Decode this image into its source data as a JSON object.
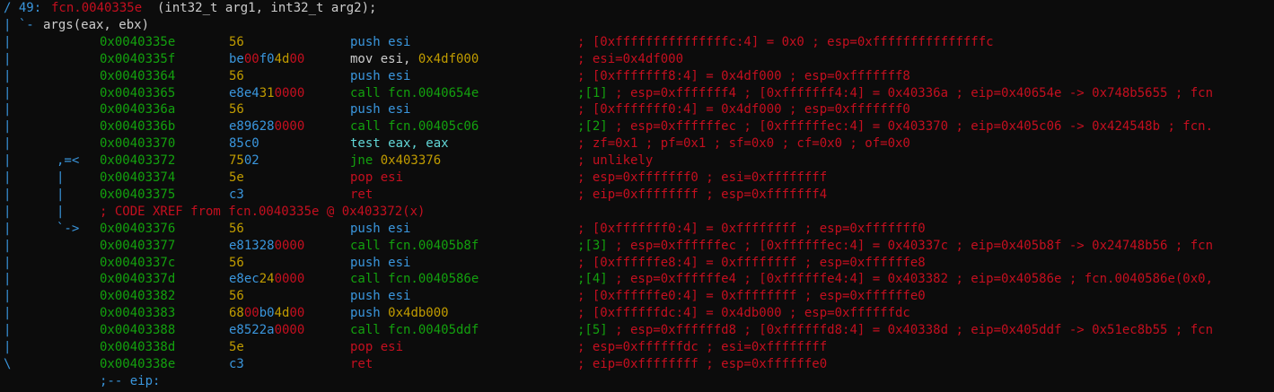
{
  "function_header": {
    "index": "/ 49:",
    "name": "fcn.0040335e",
    "signature": "(int32_t arg1, int32_t arg2);"
  },
  "args_line": {
    "prefix": "| `-",
    "text": "args(eax, ebx)"
  },
  "instructions": [
    {
      "gutter": "|",
      "addr": "0x0040335e",
      "bytes": [
        {
          "t": "56",
          "c": "yellow"
        }
      ],
      "mnemonic": [
        {
          "t": "push esi",
          "c": "blue"
        }
      ],
      "comment": [
        {
          "t": "; [0xfffffffffffffffc:4] = 0x0 ; esp=0xfffffffffffffffc",
          "c": "red"
        }
      ]
    },
    {
      "gutter": "|",
      "addr": "0x0040335f",
      "bytes": [
        {
          "t": "be",
          "c": "blue"
        },
        {
          "t": "00",
          "c": "red"
        },
        {
          "t": "f0",
          "c": "blue"
        },
        {
          "t": "4d",
          "c": "yellow"
        },
        {
          "t": "00",
          "c": "red"
        }
      ],
      "mnemonic": [
        {
          "t": "mov esi, ",
          "c": "white"
        },
        {
          "t": "0x4df000",
          "c": "yellow"
        }
      ],
      "comment": [
        {
          "t": "; esi=0x4df000",
          "c": "red"
        }
      ]
    },
    {
      "gutter": "|",
      "addr": "0x00403364",
      "bytes": [
        {
          "t": "56",
          "c": "yellow"
        }
      ],
      "mnemonic": [
        {
          "t": "push esi",
          "c": "blue"
        }
      ],
      "comment": [
        {
          "t": "; [0xfffffff8:4] = 0x4df000 ; esp=0xfffffff8",
          "c": "red"
        }
      ]
    },
    {
      "gutter": "|",
      "addr": "0x00403365",
      "bytes": [
        {
          "t": "e8e4",
          "c": "blue"
        },
        {
          "t": "31",
          "c": "yellow"
        },
        {
          "t": "0000",
          "c": "red"
        }
      ],
      "mnemonic": [
        {
          "t": "call fcn.0040654e",
          "c": "green"
        }
      ],
      "comment": [
        {
          "t": ";[1]",
          "c": "green"
        },
        {
          "t": " ; esp=0xfffffff4 ; [0xfffffff4:4] = 0x40336a ; eip=0x40654e -> 0x748b5655 ; fcn",
          "c": "red"
        }
      ]
    },
    {
      "gutter": "|",
      "addr": "0x0040336a",
      "bytes": [
        {
          "t": "56",
          "c": "yellow"
        }
      ],
      "mnemonic": [
        {
          "t": "push esi",
          "c": "blue"
        }
      ],
      "comment": [
        {
          "t": "; [0xfffffff0:4] = 0x4df000 ; esp=0xfffffff0",
          "c": "red"
        }
      ]
    },
    {
      "gutter": "|",
      "addr": "0x0040336b",
      "bytes": [
        {
          "t": "e89628",
          "c": "blue"
        },
        {
          "t": "0000",
          "c": "red"
        }
      ],
      "mnemonic": [
        {
          "t": "call fcn.00405c06",
          "c": "green"
        }
      ],
      "comment": [
        {
          "t": ";[2]",
          "c": "green"
        },
        {
          "t": " ; esp=0xffffffec ; [0xffffffec:4] = 0x403370 ; eip=0x405c06 -> 0x424548b ; fcn.",
          "c": "red"
        }
      ]
    },
    {
      "gutter": "|",
      "addr": "0x00403370",
      "bytes": [
        {
          "t": "85c0",
          "c": "blue"
        }
      ],
      "mnemonic": [
        {
          "t": "test eax, eax",
          "c": "cyan"
        }
      ],
      "comment": [
        {
          "t": "; zf=0x1 ; pf=0x1 ; sf=0x0 ; cf=0x0 ; of=0x0",
          "c": "red"
        }
      ]
    },
    {
      "gutter": "|      ,=<",
      "addr": "0x00403372",
      "bytes": [
        {
          "t": "75",
          "c": "yellow"
        },
        {
          "t": "02",
          "c": "blue"
        }
      ],
      "mnemonic": [
        {
          "t": "jne ",
          "c": "green"
        },
        {
          "t": "0x403376",
          "c": "yellow"
        }
      ],
      "comment": [
        {
          "t": "; unlikely",
          "c": "red"
        }
      ]
    },
    {
      "gutter": "|      |",
      "addr": "0x00403374",
      "bytes": [
        {
          "t": "5e",
          "c": "yellow"
        }
      ],
      "mnemonic": [
        {
          "t": "pop esi",
          "c": "red"
        }
      ],
      "comment": [
        {
          "t": "; esp=0xfffffff0 ; esi=0xffffffff",
          "c": "red"
        }
      ]
    },
    {
      "gutter": "|      |",
      "addr": "0x00403375",
      "bytes": [
        {
          "t": "c3",
          "c": "blue"
        }
      ],
      "mnemonic": [
        {
          "t": "ret",
          "c": "red"
        }
      ],
      "comment": [
        {
          "t": "; eip=0xffffffff ; esp=0xfffffff4",
          "c": "red"
        }
      ]
    }
  ],
  "xref": {
    "gutter": "|      |",
    "text": "; CODE XREF from fcn.0040335e @ 0x403372(x)"
  },
  "instructions2": [
    {
      "gutter": "|      `->",
      "addr": "0x00403376",
      "bytes": [
        {
          "t": "56",
          "c": "yellow"
        }
      ],
      "mnemonic": [
        {
          "t": "push esi",
          "c": "blue"
        }
      ],
      "comment": [
        {
          "t": "; [0xfffffff0:4] = 0xffffffff ; esp=0xfffffff0",
          "c": "red"
        }
      ]
    },
    {
      "gutter": "|",
      "addr": "0x00403377",
      "bytes": [
        {
          "t": "e81328",
          "c": "blue"
        },
        {
          "t": "0000",
          "c": "red"
        }
      ],
      "mnemonic": [
        {
          "t": "call fcn.00405b8f",
          "c": "green"
        }
      ],
      "comment": [
        {
          "t": ";[3]",
          "c": "green"
        },
        {
          "t": " ; esp=0xffffffec ; [0xffffffec:4] = 0x40337c ; eip=0x405b8f -> 0x24748b56 ; fcn",
          "c": "red"
        }
      ]
    },
    {
      "gutter": "|",
      "addr": "0x0040337c",
      "bytes": [
        {
          "t": "56",
          "c": "yellow"
        }
      ],
      "mnemonic": [
        {
          "t": "push esi",
          "c": "blue"
        }
      ],
      "comment": [
        {
          "t": "; [0xffffffe8:4] = 0xffffffff ; esp=0xffffffe8",
          "c": "red"
        }
      ]
    },
    {
      "gutter": "|",
      "addr": "0x0040337d",
      "bytes": [
        {
          "t": "e8ec",
          "c": "blue"
        },
        {
          "t": "24",
          "c": "yellow"
        },
        {
          "t": "0000",
          "c": "red"
        }
      ],
      "mnemonic": [
        {
          "t": "call fcn.0040586e",
          "c": "green"
        }
      ],
      "comment": [
        {
          "t": ";[4]",
          "c": "green"
        },
        {
          "t": " ; esp=0xffffffe4 ; [0xffffffe4:4] = 0x403382 ; eip=0x40586e ; fcn.0040586e(0x0,",
          "c": "red"
        }
      ]
    },
    {
      "gutter": "|",
      "addr": "0x00403382",
      "bytes": [
        {
          "t": "56",
          "c": "yellow"
        }
      ],
      "mnemonic": [
        {
          "t": "push esi",
          "c": "blue"
        }
      ],
      "comment": [
        {
          "t": "; [0xffffffe0:4] = 0xffffffff ; esp=0xffffffe0",
          "c": "red"
        }
      ]
    },
    {
      "gutter": "|",
      "addr": "0x00403383",
      "bytes": [
        {
          "t": "68",
          "c": "yellow"
        },
        {
          "t": "00",
          "c": "red"
        },
        {
          "t": "b0",
          "c": "blue"
        },
        {
          "t": "4d",
          "c": "yellow"
        },
        {
          "t": "00",
          "c": "red"
        }
      ],
      "mnemonic": [
        {
          "t": "push ",
          "c": "blue"
        },
        {
          "t": "0x4db000",
          "c": "yellow"
        }
      ],
      "comment": [
        {
          "t": "; [0xffffffdc:4] = 0x4db000 ; esp=0xffffffdc",
          "c": "red"
        }
      ]
    },
    {
      "gutter": "|",
      "addr": "0x00403388",
      "bytes": [
        {
          "t": "e8522a",
          "c": "blue"
        },
        {
          "t": "0000",
          "c": "red"
        }
      ],
      "mnemonic": [
        {
          "t": "call fcn.00405ddf",
          "c": "green"
        }
      ],
      "comment": [
        {
          "t": ";[5]",
          "c": "green"
        },
        {
          "t": " ; esp=0xffffffd8 ; [0xffffffd8:4] = 0x40338d ; eip=0x405ddf -> 0x51ec8b55 ; fcn",
          "c": "red"
        }
      ]
    },
    {
      "gutter": "|",
      "addr": "0x0040338d",
      "bytes": [
        {
          "t": "5e",
          "c": "yellow"
        }
      ],
      "mnemonic": [
        {
          "t": "pop esi",
          "c": "red"
        }
      ],
      "comment": [
        {
          "t": "; esp=0xffffffdc ; esi=0xffffffff",
          "c": "red"
        }
      ]
    },
    {
      "gutter": "\\",
      "addr": "0x0040338e",
      "bytes": [
        {
          "t": "c3",
          "c": "blue"
        }
      ],
      "mnemonic": [
        {
          "t": "ret",
          "c": "red"
        }
      ],
      "comment": [
        {
          "t": "; eip=0xffffffff ; esp=0xffffffe0",
          "c": "red"
        }
      ]
    }
  ],
  "footer": {
    "text": ";-- eip:"
  },
  "colors": {
    "background": "#0c0c0c",
    "white": "#cccccc",
    "blue": "#3a96dd",
    "green": "#13a10e",
    "yellow": "#c19c00",
    "cyan": "#61d6d6",
    "red": "#c50f1f"
  }
}
